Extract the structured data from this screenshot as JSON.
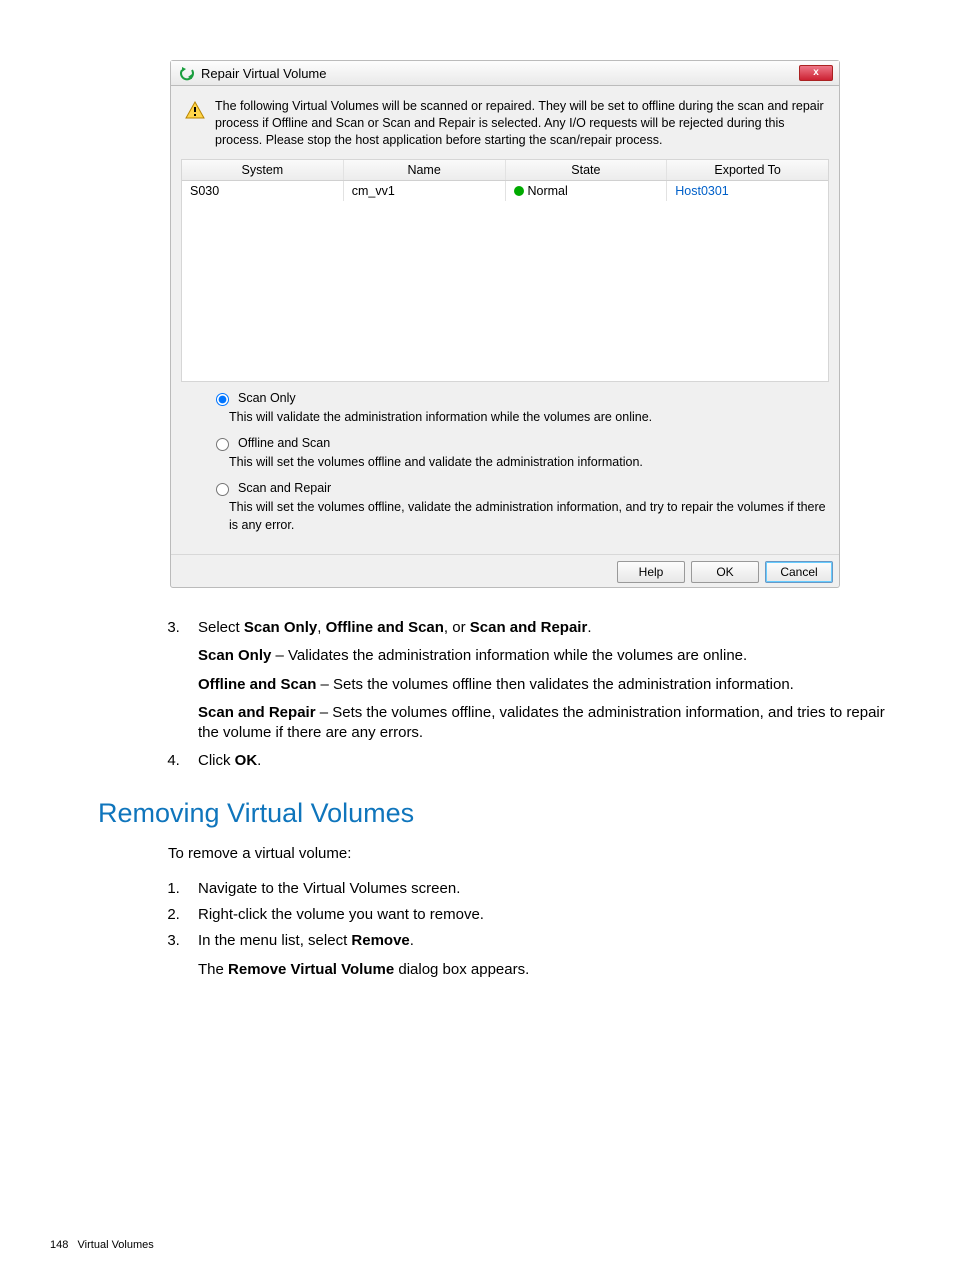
{
  "dialog": {
    "title": "Repair Virtual Volume",
    "close_glyph": "x",
    "info_text": "The following Virtual Volumes will be scanned or repaired. They will be set to offline during the scan and repair process if Offline and Scan or Scan and Repair is selected. Any I/O requests will be rejected during this process. Please stop the host application before starting the scan/repair process.",
    "columns": {
      "c1": "System",
      "c2": "Name",
      "c3": "State",
      "c4": "Exported To"
    },
    "row": {
      "system": "S030",
      "name": "cm_vv1",
      "state": "Normal",
      "exported_to": "Host0301"
    },
    "opt1": {
      "label": "Scan Only",
      "desc": "This will validate the administration information while the volumes are online."
    },
    "opt2": {
      "label": "Offline and Scan",
      "desc": "This will set the volumes offline and validate the administration information."
    },
    "opt3": {
      "label": "Scan and Repair",
      "desc": "This will set the volumes offline, validate the administration information, and try to repair the volumes if there is any error."
    },
    "buttons": {
      "help": "Help",
      "ok": "OK",
      "cancel": "Cancel"
    }
  },
  "doc": {
    "step3_a": "Select ",
    "step3_b1": "Scan Only",
    "step3_c1": ", ",
    "step3_b2": "Offline and Scan",
    "step3_c2": ", or ",
    "step3_b3": "Scan and Repair",
    "step3_c3": ".",
    "p1_b": "Scan Only",
    "p1_t": " – Validates the administration information while the volumes are online.",
    "p2_b": "Offline and Scan",
    "p2_t": " – Sets the volumes offline then validates the administration information.",
    "p3_b": "Scan and Repair",
    "p3_t": " – Sets the volumes offline, validates the administration information, and tries to repair the volume if there are any errors.",
    "step4_a": "Click ",
    "step4_b": "OK",
    "step4_c": ".",
    "h2": "Removing Virtual Volumes",
    "rem_intro": "To remove a virtual volume:",
    "rem_s1": "Navigate to the Virtual Volumes screen.",
    "rem_s2": "Right-click the volume you want to remove.",
    "rem_s3_a": "In the menu list, select ",
    "rem_s3_b": "Remove",
    "rem_s3_c": ".",
    "rem_s3_p_a": "The ",
    "rem_s3_p_b": "Remove Virtual Volume",
    "rem_s3_p_c": " dialog box appears."
  },
  "footer": {
    "page": "148",
    "section": "Virtual Volumes"
  }
}
